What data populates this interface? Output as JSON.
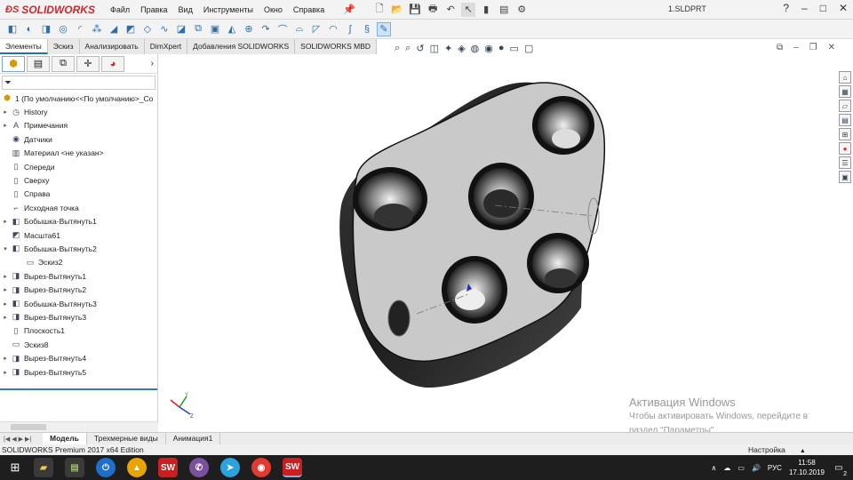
{
  "app": {
    "brand": "SOLIDWORKS",
    "doc_title": "1.SLDPRT",
    "menu": [
      "Файл",
      "Правка",
      "Вид",
      "Инструменты",
      "Окно",
      "Справка"
    ],
    "window_controls": [
      "?",
      "–",
      "□",
      "✕"
    ]
  },
  "cmd_tabs": [
    {
      "label": "Элементы",
      "active": true
    },
    {
      "label": "Эскиз",
      "active": false
    },
    {
      "label": "Анализировать",
      "active": false
    },
    {
      "label": "DimXpert",
      "active": false
    },
    {
      "label": "Добавления SOLIDWORKS",
      "active": false
    },
    {
      "label": "SOLIDWORKS MBD",
      "active": false
    }
  ],
  "tree": [
    {
      "label": "1  (По умолчанию<<По умолчанию>_Со",
      "arrow": "",
      "icon": "part-icon"
    },
    {
      "label": "History",
      "arrow": "▸",
      "icon": "history-icon"
    },
    {
      "label": "Примечания",
      "arrow": "▸",
      "icon": "annotations-icon"
    },
    {
      "label": "Датчики",
      "arrow": "",
      "icon": "sensors-icon"
    },
    {
      "label": "Материал <не указан>",
      "arrow": "",
      "icon": "material-icon"
    },
    {
      "label": "Спереди",
      "arrow": "",
      "icon": "plane-icon"
    },
    {
      "label": "Сверху",
      "arrow": "",
      "icon": "plane-icon"
    },
    {
      "label": "Справа",
      "arrow": "",
      "icon": "plane-icon"
    },
    {
      "label": "Исходная точка",
      "arrow": "",
      "icon": "origin-icon"
    },
    {
      "label": "Бобышка-Вытянуть1",
      "arrow": "▸",
      "icon": "boss-extrude-icon"
    },
    {
      "label": "Масшта61",
      "arrow": "",
      "icon": "scale-icon"
    },
    {
      "label": "Бобышка-Вытянуть2",
      "arrow": "▾",
      "icon": "boss-extrude-icon"
    },
    {
      "label": "Эскиз2",
      "arrow": "",
      "icon": "sketch-icon",
      "indent": true
    },
    {
      "label": "Вырез-Вытянуть1",
      "arrow": "▸",
      "icon": "cut-extrude-icon"
    },
    {
      "label": "Вырез-Вытянуть2",
      "arrow": "▸",
      "icon": "cut-extrude-icon"
    },
    {
      "label": "Бобышка-Вытянуть3",
      "arrow": "▸",
      "icon": "boss-extrude-icon"
    },
    {
      "label": "Вырез-Вытянуть3",
      "arrow": "▸",
      "icon": "cut-extrude-icon"
    },
    {
      "label": "Плоскость1",
      "arrow": "",
      "icon": "plane-icon"
    },
    {
      "label": "Эскиз8",
      "arrow": "",
      "icon": "sketch-icon"
    },
    {
      "label": "Вырез-Вытянуть4",
      "arrow": "▸",
      "icon": "cut-extrude-icon"
    },
    {
      "label": "Вырез-Вытянуть5",
      "arrow": "▸",
      "icon": "cut-extrude-icon"
    }
  ],
  "bottom_tabs": [
    {
      "label": "Модель",
      "active": true
    },
    {
      "label": "Трехмерные виды",
      "active": false
    },
    {
      "label": "Анимация1",
      "active": false
    }
  ],
  "status": {
    "left": "SOLIDWORKS Premium 2017 x64 Edition",
    "right": "Настройка"
  },
  "watermark": {
    "title": "Активация Windows",
    "line1": "Чтобы активировать Windows, перейдите в",
    "line2": "раздел \"Параметры\"."
  },
  "taskbar": {
    "lang": "РУС",
    "time": "11:58",
    "date": "17.10.2019",
    "notifications": "2"
  },
  "colors": {
    "brand_red": "#d3242a",
    "accent_blue": "#2f7cc4",
    "taskbar": "#1e1e1e"
  }
}
